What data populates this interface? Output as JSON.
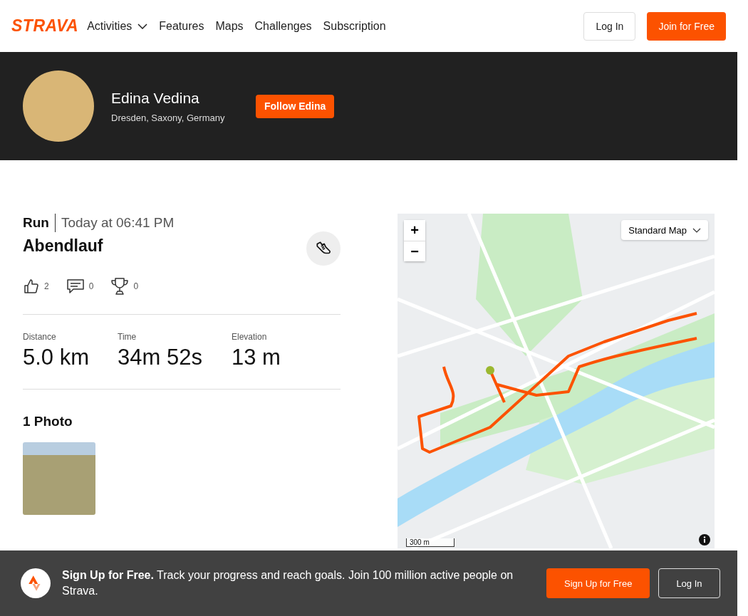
{
  "nav": {
    "logo": "STRAVA",
    "links": [
      {
        "label": "Activities",
        "dropdown": true
      },
      {
        "label": "Features",
        "dropdown": false
      },
      {
        "label": "Maps",
        "dropdown": false
      },
      {
        "label": "Challenges",
        "dropdown": false
      },
      {
        "label": "Subscription",
        "dropdown": false
      }
    ],
    "login": "Log In",
    "join": "Join for Free"
  },
  "profile": {
    "name": "Edina Vedina",
    "location": "Dresden, Saxony, Germany",
    "follow": "Follow Edina"
  },
  "activity": {
    "type": "Run",
    "time": "Today at 06:41 PM",
    "title": "Abendlauf",
    "kudos": "2",
    "comments": "0",
    "achievements": "0",
    "stats": [
      {
        "label": "Distance",
        "value": "5.0 km"
      },
      {
        "label": "Time",
        "value": "34m 52s"
      },
      {
        "label": "Elevation",
        "value": "13 m"
      }
    ],
    "photos_heading": "1 Photo"
  },
  "map": {
    "style": "Standard Map",
    "zoom_in": "+",
    "zoom_out": "−",
    "scale": "300 m"
  },
  "banner": {
    "text": "**Sign Up for Free.** Track your progress and reach goals. Join 100 million active people on Strava.",
    "signup": "Sign Up for Free",
    "login": "Log In"
  }
}
